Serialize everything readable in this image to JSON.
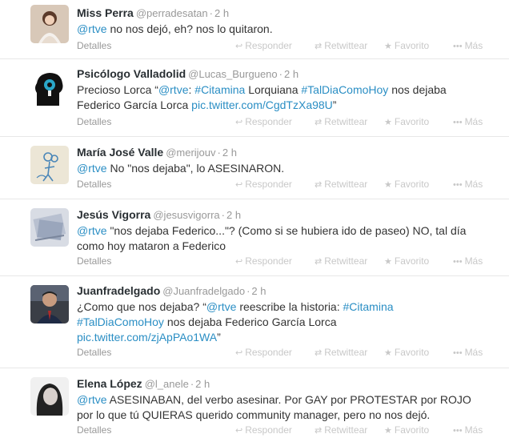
{
  "actions": {
    "details": "Detalles",
    "reply": "Responder",
    "retweet": "Retwittear",
    "favorite": "Favorito",
    "more": "Más"
  },
  "icons": {
    "reply": "reply-arrow-icon",
    "retweet": "retweet-icon",
    "favorite": "star-icon",
    "more": "ellipsis-icon"
  },
  "colors": {
    "link": "#2a8ec4",
    "muted": "#999999",
    "action": "#c8c8c8",
    "divider": "#e8e8e8"
  },
  "tweets": [
    {
      "fullname": "Miss Perra",
      "username": "@perradesatan",
      "time": "2 h",
      "text_parts": [
        {
          "t": "@rtve",
          "link": true
        },
        {
          "t": " no nos dejó, eh? nos lo quitaron.",
          "link": false
        }
      ]
    },
    {
      "fullname": "Psicólogo Valladolid",
      "username": "@Lucas_Burgueno",
      "time": "2 h",
      "text_parts": [
        {
          "t": "Precioso Lorca “",
          "link": false
        },
        {
          "t": "@rtve",
          "link": true
        },
        {
          "t": ": ",
          "link": false
        },
        {
          "t": "#Citamina",
          "link": true
        },
        {
          "t": " Lorquiana ",
          "link": false
        },
        {
          "t": "#TalDiaComoHoy",
          "link": true
        },
        {
          "t": " nos dejaba Federico García Lorca ",
          "link": false
        },
        {
          "t": "pic.twitter.com/CgdTzXa98U",
          "link": true
        },
        {
          "t": "”",
          "link": false
        }
      ]
    },
    {
      "fullname": "María José Valle",
      "username": "@merijouv",
      "time": "2 h",
      "text_parts": [
        {
          "t": "@rtve",
          "link": true
        },
        {
          "t": " No \"nos dejaba\", lo ASESINARON.",
          "link": false
        }
      ]
    },
    {
      "fullname": "Jesús Vigorra",
      "username": "@jesusvigorra",
      "time": "2 h",
      "text_parts": [
        {
          "t": "@rtve",
          "link": true
        },
        {
          "t": " \"nos dejaba Federico...\"? (Como si se hubiera ido de paseo)  NO, tal día como hoy mataron a Federico",
          "link": false
        }
      ]
    },
    {
      "fullname": "Juanfradelgado",
      "username": "@Juanfradelgado",
      "time": "2 h",
      "text_parts": [
        {
          "t": "¿Como que nos dejaba? “",
          "link": false
        },
        {
          "t": "@rtve",
          "link": true
        },
        {
          "t": " reescribe la historia: ",
          "link": false
        },
        {
          "t": "#Citamina",
          "link": true
        },
        {
          "t": " ",
          "link": false
        },
        {
          "t": "#TalDiaComoHoy",
          "link": true
        },
        {
          "t": " nos dejaba Federico García Lorca ",
          "link": false
        },
        {
          "t": "pic.twitter.com/zjApPAo1WA",
          "link": true
        },
        {
          "t": "”",
          "link": false
        }
      ]
    },
    {
      "fullname": "Elena López",
      "username": "@l_anele",
      "time": "2 h",
      "text_parts": [
        {
          "t": "@rtve",
          "link": true
        },
        {
          "t": " ASESINABAN, del verbo asesinar. Por GAY por PROTESTAR por ROJO por lo que tú QUIERAS querido community manager, pero no nos dejó.",
          "link": false
        }
      ]
    }
  ]
}
